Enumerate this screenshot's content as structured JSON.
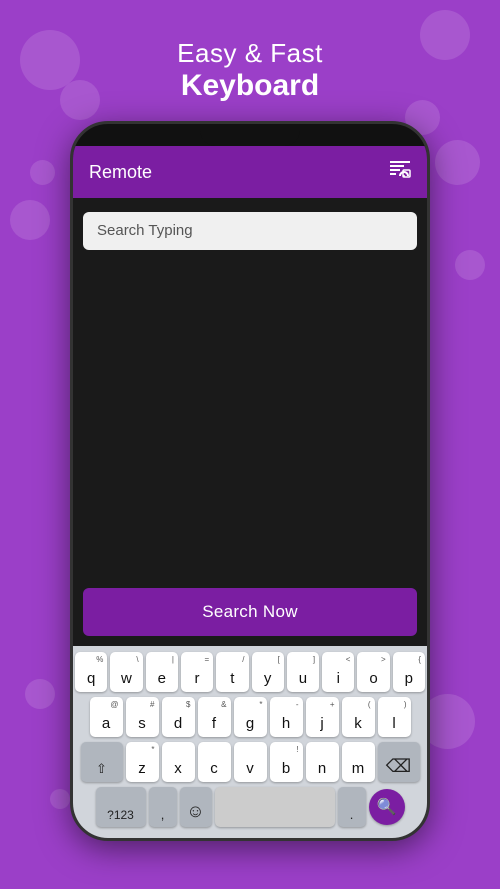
{
  "background_color": "#9b3fc8",
  "header": {
    "line1": "Easy & Fast",
    "line2": "Keyboard"
  },
  "appbar": {
    "title": "Remote",
    "cast_icon": "⊡"
  },
  "search": {
    "placeholder": "Search Typing",
    "button_label": "Search Now"
  },
  "keyboard": {
    "row1": [
      "q",
      "w",
      "e",
      "r",
      "t",
      "y",
      "u",
      "i",
      "o",
      "p"
    ],
    "row1_symbols": [
      "%",
      "\\",
      "|",
      "=",
      "/",
      "[",
      "]",
      "<",
      ">",
      "{"
    ],
    "row2": [
      "a",
      "s",
      "d",
      "f",
      "g",
      "h",
      "j",
      "k",
      "l"
    ],
    "row2_symbols": [
      "@",
      "#",
      "$",
      "&",
      "*",
      "-",
      "+",
      "(",
      ")"
    ],
    "row3": [
      "z",
      "x",
      "c",
      "v",
      "b",
      "n",
      "m"
    ],
    "bottom": {
      "symbols_label": "?123",
      "emoji_icon": "☺",
      "period": "."
    }
  }
}
